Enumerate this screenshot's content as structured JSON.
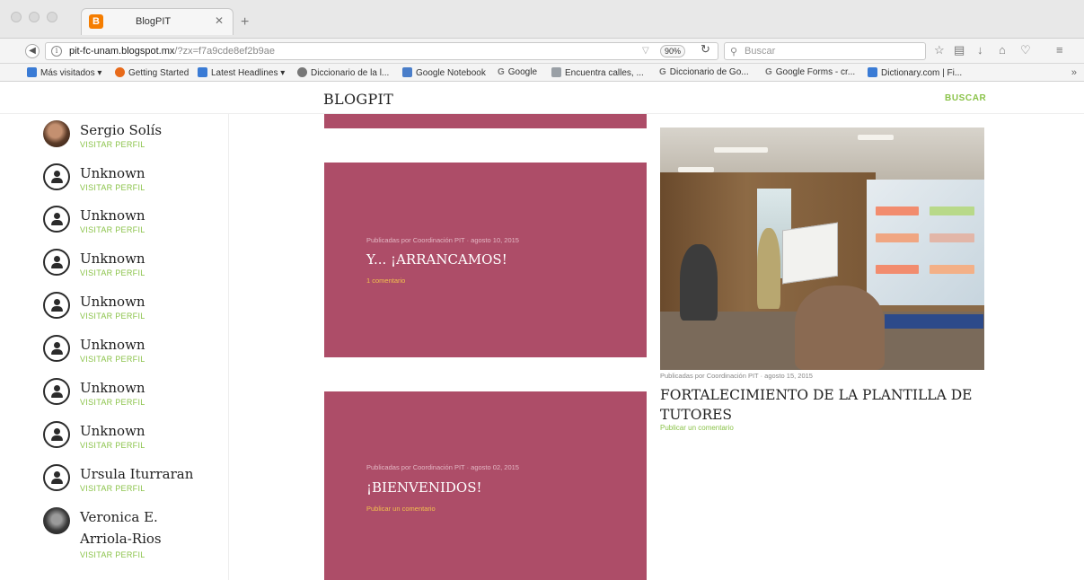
{
  "browser": {
    "tab_title": "BlogPIT",
    "tab_favicon": "B",
    "tab_close": "✕",
    "new_tab": "+",
    "url_host": "pit-fc-unam.blogspot.mx",
    "url_query": "/?zx=f7a9cde8ef2b9ae",
    "zoom": "90%",
    "search_placeholder": "Buscar",
    "bookmarks": [
      {
        "label": "Más visitados ▾",
        "icon": "folder-icon",
        "color": "#3a7bd5"
      },
      {
        "label": "Getting Started",
        "icon": "firefox-icon",
        "color": "#e86a1a"
      },
      {
        "label": "Latest Headlines ▾",
        "icon": "rss-icon",
        "color": "#3a7bd5"
      },
      {
        "label": "Diccionario de la l...",
        "icon": "globe-icon",
        "color": "#777777"
      },
      {
        "label": "Google Notebook",
        "icon": "notebook-icon",
        "color": "#4a7ec9"
      },
      {
        "label": "Google",
        "icon": "google-g-icon",
        "color": "#777777"
      },
      {
        "label": "Encuentra calles, ...",
        "icon": "maps-icon",
        "color": "#9aa0a6"
      },
      {
        "label": "Diccionario de Go...",
        "icon": "google-g-icon",
        "color": "#777777"
      },
      {
        "label": "Google Forms - cr...",
        "icon": "google-g-icon",
        "color": "#777777"
      },
      {
        "label": "Dictionary.com | Fi...",
        "icon": "dictionary-icon",
        "color": "#3a7bd5"
      }
    ]
  },
  "blog": {
    "title": "BLOGPIT",
    "search_label": "BUSCAR",
    "accent_color": "#8bc34a",
    "card_color": "#ad4d68"
  },
  "contributors": [
    {
      "name": "Sergio Solís",
      "link": "VISITAR PERFIL",
      "avatar": "photo1"
    },
    {
      "name": "Unknown",
      "link": "VISITAR PERFIL",
      "avatar": "unknown"
    },
    {
      "name": "Unknown",
      "link": "VISITAR PERFIL",
      "avatar": "unknown"
    },
    {
      "name": "Unknown",
      "link": "VISITAR PERFIL",
      "avatar": "unknown"
    },
    {
      "name": "Unknown",
      "link": "VISITAR PERFIL",
      "avatar": "unknown"
    },
    {
      "name": "Unknown",
      "link": "VISITAR PERFIL",
      "avatar": "unknown"
    },
    {
      "name": "Unknown",
      "link": "VISITAR PERFIL",
      "avatar": "unknown"
    },
    {
      "name": "Unknown",
      "link": "VISITAR PERFIL",
      "avatar": "unknown"
    },
    {
      "name": "Ursula Iturraran",
      "link": "VISITAR PERFIL",
      "avatar": "unknown"
    },
    {
      "name": "Veronica E.",
      "name2": "Arriola-Rios",
      "link": "VISITAR PERFIL",
      "avatar": "photo2"
    }
  ],
  "posts": [
    {
      "meta": "Publicadas por Coordinación PIT · agosto 10, 2015",
      "title": "Y... ¡ARRANCAMOS!",
      "comment": "1 comentario"
    },
    {
      "meta": "Publicadas por Coordinación PIT · agosto 02, 2015",
      "title": "¡BIENVENIDOS!",
      "comment": "Publicar un comentario"
    },
    {
      "meta": "Publicadas por Coordinación PIT · agosto 15, 2015",
      "title": "FORTALECIMIENTO DE LA PLANTILLA DE TUTORES",
      "comment": "Publicar un comentario"
    }
  ]
}
